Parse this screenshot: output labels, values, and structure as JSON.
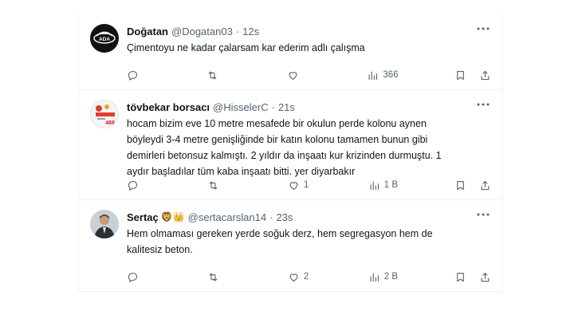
{
  "tweets": [
    {
      "name": "Doğatan",
      "handle": "@Dogatan03",
      "time": "12s",
      "text": "Çimentoyu ne kadar çalarsam kar ederim adlı çalışma",
      "replies": "",
      "retweets": "",
      "likes": "",
      "views": "366",
      "avatar_label": "ADA"
    },
    {
      "name": "tövbekar borsacı",
      "handle": "@HisselerC",
      "time": "21s",
      "text": "hocam bizim eve 10 metre mesafede bir okulun perde kolonu aynen\nböyleydi 3-4 metre genişliğinde bir katın kolonu tamamen bunun gibi\ndemirleri betonsuz kalmıştı. 2 yıldır da inşaatı kur krizinden durmuştu. 1\naydır başladılar tüm kaba inşaatı bitti. yer diyarbakır",
      "replies": "",
      "retweets": "",
      "likes": "1",
      "views": "1 B",
      "avatar_label": "488"
    },
    {
      "name": "Sertaç",
      "name_emojis": "🦁👑",
      "handle": "@sertacarslan14",
      "time": "23s",
      "text": "Hem olmaması gereken yerde soğuk derz, hem segregasyon hem de\nkalitesiz beton.",
      "replies": "",
      "retweets": "",
      "likes": "2",
      "views": "2 B"
    }
  ],
  "icons": {
    "reply": "reply-icon",
    "retweet": "retweet-icon",
    "like": "heart-icon",
    "views": "views-icon",
    "bookmark": "bookmark-icon",
    "share": "share-icon",
    "more": "more-icon"
  },
  "colors": {
    "text": "#0f1419",
    "secondary": "#536471",
    "border": "#eff3f4"
  }
}
